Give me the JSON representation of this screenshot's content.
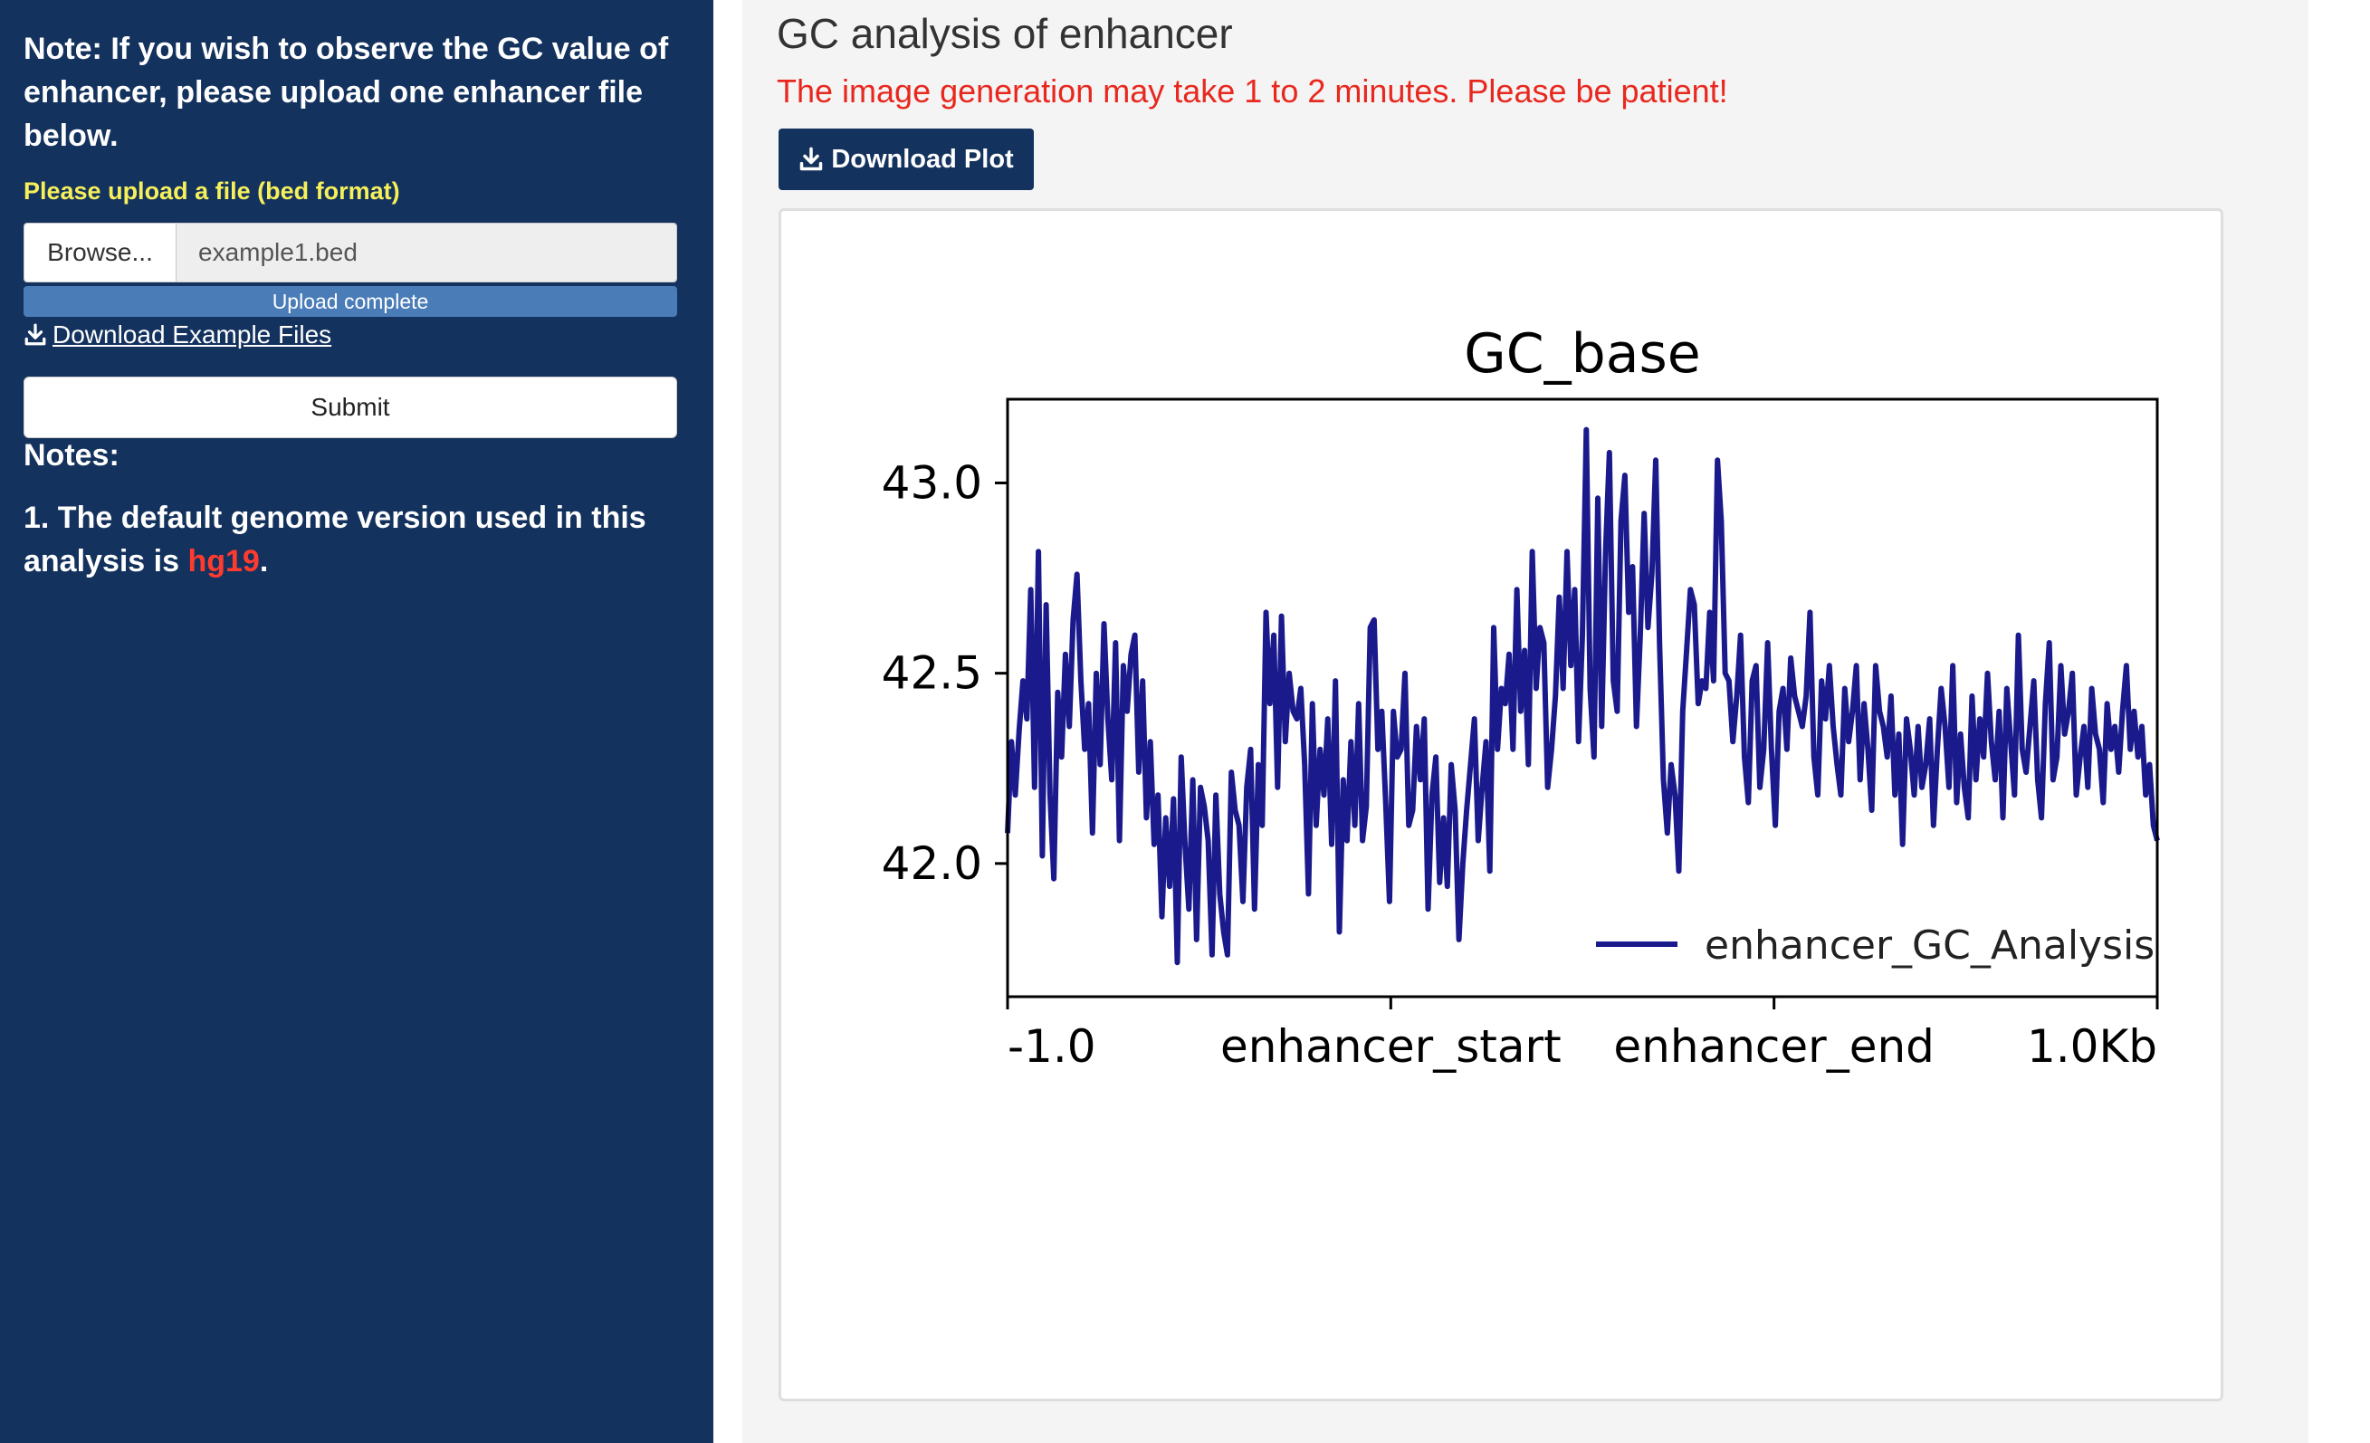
{
  "sidebar": {
    "note": "Note: If you wish to observe the GC value of enhancer, please upload one enhancer file below.",
    "upload_label": "Please upload a file (bed format)",
    "browse_label": "Browse...",
    "file_name": "example1.bed",
    "upload_status": "Upload complete",
    "upload_progress": 1.0,
    "download_example_label": "Download Example Files",
    "submit_label": "Submit",
    "notes_heading": "Notes:",
    "notes_item_prefix": "1. The default genome version used in this analysis is ",
    "notes_item_genome": "hg19",
    "notes_item_suffix": "."
  },
  "main": {
    "title": "GC analysis of enhancer",
    "warning": "The image generation may take 1 to 2 minutes. Please be patient!",
    "download_plot_label": "Download Plot"
  },
  "colors": {
    "sidebar_bg": "#14325e",
    "upload_label": "#f6f05a",
    "warning": "#e8281e",
    "genome_highlight": "#ff3b30",
    "progress": "#4a7cb8",
    "series_line": "#1a1a8c"
  },
  "icons": {
    "download": "download-icon"
  },
  "chart_data": {
    "type": "line",
    "title": "GC_base",
    "xlabel": "",
    "ylabel": "",
    "xlim": [
      0,
      300
    ],
    "ylim": [
      41.65,
      43.22
    ],
    "yticks": [
      42.0,
      42.5,
      43.0
    ],
    "ytick_labels": [
      "42.0",
      "42.5",
      "43.0"
    ],
    "xticks": [
      0,
      100,
      200,
      300
    ],
    "xtick_labels": [
      "-1.0",
      "enhancer_start",
      "enhancer_end",
      "1.0Kb"
    ],
    "legend_position": "lower right",
    "grid": false,
    "series": [
      {
        "name": "enhancer_GC_Analysis",
        "color": "#1a1a8c",
        "values": [
          42.08,
          42.32,
          42.18,
          42.35,
          42.48,
          42.38,
          42.72,
          42.2,
          42.82,
          42.02,
          42.68,
          42.18,
          41.96,
          42.45,
          42.28,
          42.55,
          42.36,
          42.64,
          42.76,
          42.48,
          42.3,
          42.42,
          42.08,
          42.5,
          42.26,
          42.63,
          42.38,
          42.22,
          42.58,
          42.06,
          42.52,
          42.4,
          42.55,
          42.6,
          42.24,
          42.48,
          42.12,
          42.32,
          42.05,
          42.18,
          41.86,
          42.12,
          41.94,
          42.17,
          41.74,
          42.28,
          42.05,
          41.88,
          42.22,
          41.8,
          42.2,
          42.15,
          42.06,
          41.76,
          42.18,
          41.92,
          41.82,
          41.76,
          42.24,
          42.14,
          42.1,
          41.9,
          42.2,
          42.3,
          41.88,
          42.26,
          42.1,
          42.66,
          42.42,
          42.6,
          42.2,
          42.65,
          42.32,
          42.5,
          42.4,
          42.38,
          42.46,
          42.26,
          41.92,
          42.42,
          42.1,
          42.3,
          42.18,
          42.38,
          42.05,
          42.48,
          41.82,
          42.22,
          42.06,
          42.32,
          42.1,
          42.42,
          42.06,
          42.15,
          42.62,
          42.64,
          42.3,
          42.4,
          42.16,
          41.9,
          42.4,
          42.28,
          42.3,
          42.5,
          42.1,
          42.14,
          42.36,
          42.22,
          42.38,
          41.88,
          42.18,
          42.28,
          41.95,
          42.12,
          41.94,
          42.26,
          42.14,
          41.8,
          42.0,
          42.14,
          42.26,
          42.38,
          42.06,
          42.2,
          42.32,
          41.98,
          42.62,
          42.3,
          42.46,
          42.42,
          42.55,
          42.3,
          42.72,
          42.4,
          42.56,
          42.26,
          42.82,
          42.46,
          42.62,
          42.58,
          42.2,
          42.3,
          42.44,
          42.7,
          42.46,
          42.82,
          42.52,
          42.72,
          42.32,
          42.6,
          43.14,
          42.46,
          42.28,
          42.96,
          42.36,
          42.82,
          43.08,
          42.48,
          42.4,
          42.9,
          43.02,
          42.66,
          42.78,
          42.36,
          42.6,
          42.92,
          42.62,
          42.76,
          43.06,
          42.58,
          42.22,
          42.08,
          42.26,
          42.18,
          41.98,
          42.4,
          42.56,
          42.72,
          42.68,
          42.42,
          42.48,
          42.46,
          42.66,
          42.48,
          43.06,
          42.9,
          42.5,
          42.48,
          42.32,
          42.44,
          42.6,
          42.28,
          42.16,
          42.48,
          42.52,
          42.2,
          42.3,
          42.58,
          42.3,
          42.1,
          42.4,
          42.46,
          42.3,
          42.54,
          42.44,
          42.4,
          42.36,
          42.44,
          42.66,
          42.28,
          42.18,
          42.48,
          42.38,
          42.52,
          42.36,
          42.26,
          42.18,
          42.46,
          42.32,
          42.4,
          42.52,
          42.22,
          42.42,
          42.3,
          42.14,
          42.52,
          42.4,
          42.36,
          42.28,
          42.44,
          42.18,
          42.34,
          42.05,
          42.38,
          42.3,
          42.18,
          42.36,
          42.2,
          42.26,
          42.38,
          42.1,
          42.3,
          42.46,
          42.36,
          42.2,
          42.52,
          42.16,
          42.34,
          42.2,
          42.12,
          42.44,
          42.22,
          42.38,
          42.28,
          42.5,
          42.32,
          42.22,
          42.4,
          42.12,
          42.46,
          42.32,
          42.18,
          42.6,
          42.3,
          42.24,
          42.36,
          42.48,
          42.22,
          42.12,
          42.42,
          42.58,
          42.22,
          42.28,
          42.52,
          42.34,
          42.4,
          42.5,
          42.18,
          42.28,
          42.36,
          42.2,
          42.46,
          42.34,
          42.3,
          42.16,
          42.42,
          42.3,
          42.36,
          42.24,
          42.4,
          42.52,
          42.3,
          42.4,
          42.28,
          42.36,
          42.18,
          42.26,
          42.1,
          42.06
        ]
      }
    ]
  }
}
